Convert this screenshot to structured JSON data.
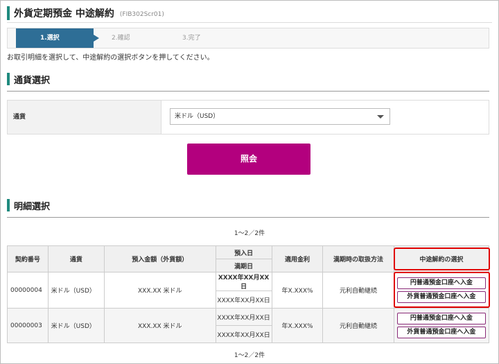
{
  "page": {
    "title": "外貨定期預金 中途解約",
    "screen_code": "(FIB302Scr01)",
    "instruction": "お取引明細を選択して、中途解約の選択ボタンを押してください。"
  },
  "steps": [
    {
      "label": "1.選択",
      "active": true
    },
    {
      "label": "2.確認",
      "active": false
    },
    {
      "label": "3.完了",
      "active": false
    }
  ],
  "currency_section": {
    "heading": "通貨選択",
    "field_label": "通貨",
    "selected_value": "米ドル（USD）",
    "inquiry_button": "照会"
  },
  "detail_section": {
    "heading": "明細選択",
    "count_top": "1～2／2件",
    "count_bottom": "1～2／2件",
    "columns": {
      "contract_no": "契約番号",
      "currency": "通貨",
      "amount": "預入金額（外貨額）",
      "deposit_date": "預入日",
      "maturity_date": "満期日",
      "rate": "適用金利",
      "maturity_method": "満期時の取扱方法",
      "cancel_select": "中途解約の選択"
    },
    "rows": [
      {
        "contract_no": "00000004",
        "currency": "米ドル（USD）",
        "amount": "XXX.XX 米ドル",
        "deposit_date": "XXXX年XX月XX日",
        "maturity_date": "XXXX年XX月XX日",
        "rate": "年X.XXX%",
        "maturity_method": "元利自動継続",
        "btn_yen": "円普通預金口座へ入金",
        "btn_fx": "外貨普通預金口座へ入金"
      },
      {
        "contract_no": "00000003",
        "currency": "米ドル（USD）",
        "amount": "XXX.XX 米ドル",
        "deposit_date": "XXXX年XX月XX日",
        "maturity_date": "XXXX年XX月XX日",
        "rate": "年X.XXX%",
        "maturity_method": "元利自動継続",
        "btn_yen": "円普通預金口座へ入金",
        "btn_fx": "外貨普通預金口座へ入金"
      }
    ]
  },
  "colors": {
    "accent": "#1f8a7e",
    "step_active": "#2e6e96",
    "inquiry_button": "#b3007e",
    "highlight": "#e00000"
  }
}
